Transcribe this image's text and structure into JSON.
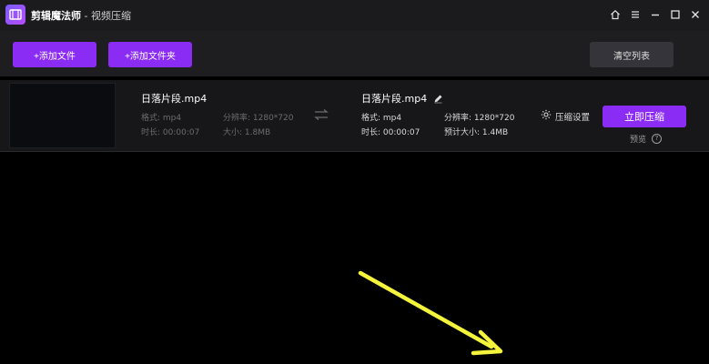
{
  "app": {
    "name": "剪辑魔法师",
    "separator": " - ",
    "module": "视频压缩"
  },
  "toolbar": {
    "add_file": "+添加文件",
    "add_folder": "+添加文件夹",
    "clear_list": "清空列表"
  },
  "file": {
    "source": {
      "name": "日落片段.mp4",
      "format_label": "格式: mp4",
      "resolution_label": "分辨率: 1280*720",
      "duration_label": "时长: 00:00:07",
      "size_label": "大小: 1.8MB"
    },
    "output": {
      "name": "日落片段.mp4",
      "format_label": "格式: mp4",
      "resolution_label": "分辨率: 1280*720",
      "duration_label": "时长: 00:00:07",
      "size_label": "预计大小: 1.4MB"
    },
    "settings_label": "压缩设置",
    "compress_label": "立即压缩",
    "preview_label": "预览",
    "help_glyph": "?"
  },
  "colors": {
    "accent": "#8b2cf5",
    "annotation_arrow": "#f4f43c"
  },
  "icons": {
    "home": "home-icon",
    "menu": "menu-icon",
    "minimize": "minimize-icon",
    "maximize": "maximize-icon",
    "close": "close-icon",
    "swap": "swap-arrows-icon",
    "edit": "pencil-icon",
    "settings": "gear-icon"
  }
}
